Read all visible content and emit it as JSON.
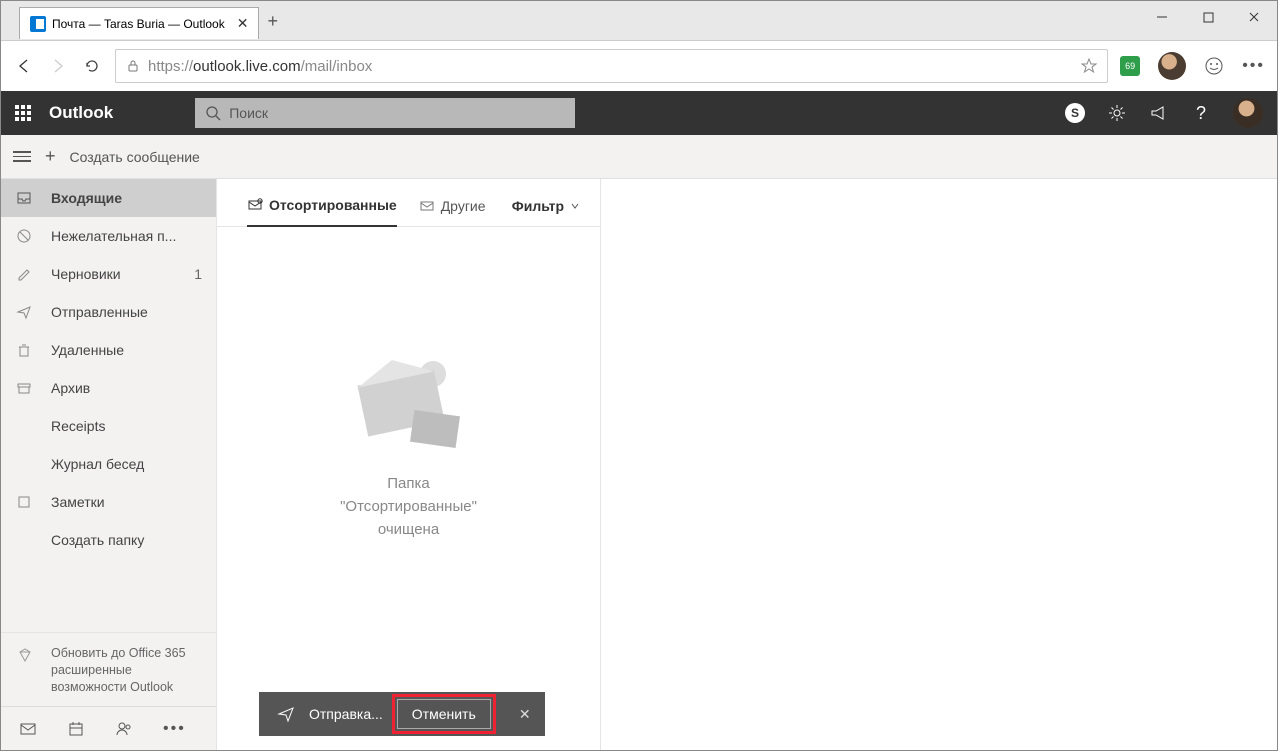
{
  "browser": {
    "tab_title": "Почта — Taras Buria — Outlook",
    "url_prefix": "https://",
    "url_host": "outlook.live.com",
    "url_path": "/mail/inbox",
    "ext_badge": "69"
  },
  "header": {
    "brand": "Outlook",
    "search_placeholder": "Поиск"
  },
  "cmdbar": {
    "new_msg": "Создать сообщение"
  },
  "sidebar": {
    "folders": [
      {
        "label": "Входящие"
      },
      {
        "label": "Нежелательная п..."
      },
      {
        "label": "Черновики",
        "count": "1"
      },
      {
        "label": "Отправленные"
      },
      {
        "label": "Удаленные"
      },
      {
        "label": "Архив"
      },
      {
        "label": "Receipts"
      },
      {
        "label": "Журнал бесед"
      },
      {
        "label": "Заметки"
      },
      {
        "label": "Создать папку"
      }
    ],
    "upgrade": "Обновить до Office 365 расширенные возможности Outlook"
  },
  "pivot": {
    "focused": "Отсортированные",
    "other": "Другие",
    "filter": "Фильтр"
  },
  "empty": {
    "line1": "Папка",
    "line2": "\"Отсортированные\"",
    "line3": "очищена"
  },
  "toast": {
    "sending": "Отправка...",
    "cancel": "Отменить"
  }
}
